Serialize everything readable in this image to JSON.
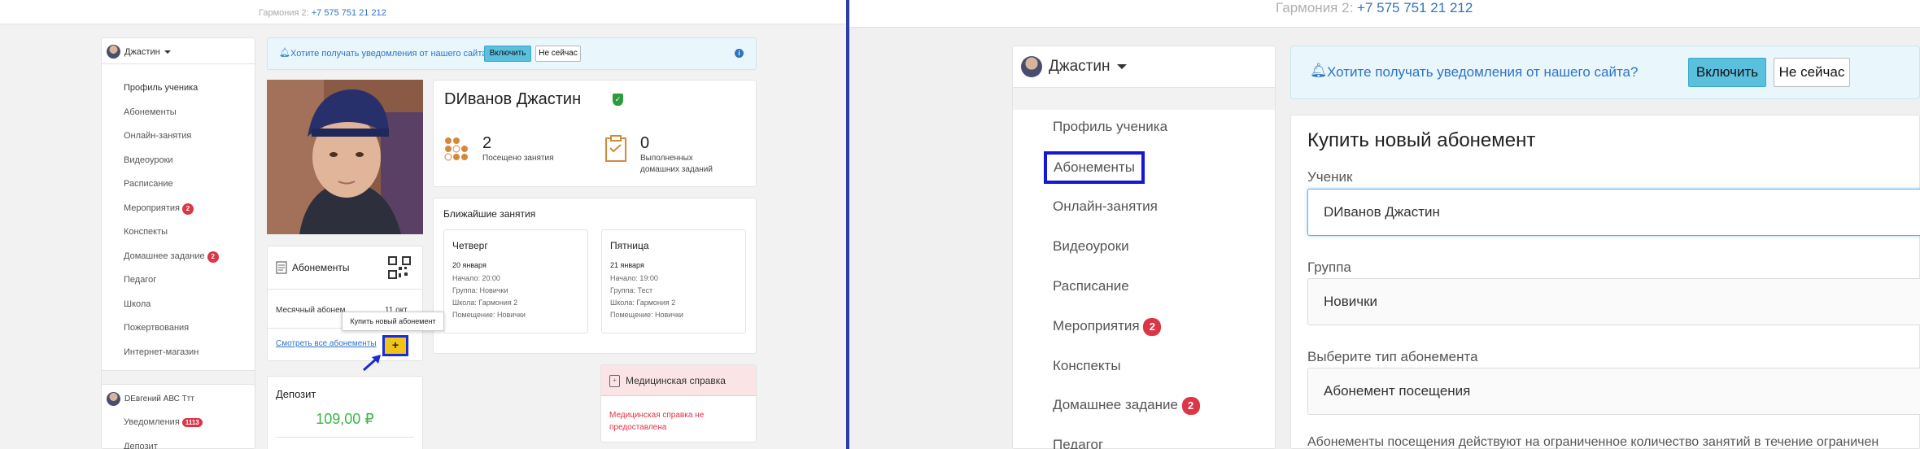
{
  "header": {
    "phone_label": "Гармония 2:",
    "phone_number": "+7 575 751 21 212"
  },
  "user": {
    "name": "Джастин"
  },
  "menu": {
    "items": [
      {
        "label": "Профиль ученика"
      },
      {
        "label": "Абонементы"
      },
      {
        "label": "Онлайн-занятия"
      },
      {
        "label": "Видеоуроки"
      },
      {
        "label": "Расписание"
      },
      {
        "label": "Мероприятия",
        "badge": "2"
      },
      {
        "label": "Конспекты"
      },
      {
        "label": "Домашнее задание",
        "badge": "2"
      },
      {
        "label": "Педагог"
      },
      {
        "label": "Школа"
      },
      {
        "label": "Пожертвования"
      },
      {
        "label": "Интернет-магазин"
      }
    ]
  },
  "second_user": {
    "name": "DEвгений АВС Ттт",
    "notifications_label": "Уведомления",
    "notifications_count": "1113",
    "deposit_label": "Депозит"
  },
  "notification_prompt": {
    "text": "Хотите получать уведомления от нашего сайта?",
    "enable_label": "Включить",
    "later_label": "Не сейчас"
  },
  "profile": {
    "name": "DИванов Джастин",
    "visited_count": "2",
    "visited_label": "Посещено занятия",
    "homework_count": "0",
    "homework_label_1": "Выполненных",
    "homework_label_2": "домашних заданий"
  },
  "upcoming": {
    "title": "Ближайшие занятия",
    "lessons": [
      {
        "day": "Четверг",
        "date": "20 января",
        "start": "Начало: 20:00",
        "group": "Группа: Новички",
        "school": "Школа: Гармония 2",
        "room": "Помещение: Новички"
      },
      {
        "day": "Пятница",
        "date": "21 января",
        "start": "Начало: 19:00",
        "group": "Группа: Тест",
        "school": "Школа: Гармония 2",
        "room": "Помещение: Новички"
      }
    ]
  },
  "subscriptions": {
    "title": "Абонементы",
    "row_text": "Месячный абонем",
    "row_value": "11 окт",
    "view_all": "Смотреть все абонементы",
    "tooltip": "Купить новый абонемент",
    "plus": "+"
  },
  "deposit": {
    "title": "Депозит",
    "amount": "109,00 ₽"
  },
  "medical": {
    "title": "Медицинская справка",
    "status_1": "Медицинская справка не",
    "status_2": "предоставлена"
  },
  "buy_form": {
    "title": "Купить новый абонемент",
    "student_label": "Ученик",
    "student_value": "DИванов Джастин",
    "group_label": "Группа",
    "group_value": "Новички",
    "type_label": "Выберите тип абонемента",
    "type_value": "Абонемент посещения",
    "note": "Абонементы посещения действуют на ограниченное количество занятий в течение ограничен"
  },
  "colors": {
    "accent": "#5bc0de",
    "link": "#2e74c4",
    "badge": "#dc3545",
    "deposit_amount": "#3bb54a",
    "highlight": "#1515d6",
    "medical_bg": "#fbe4e6"
  }
}
